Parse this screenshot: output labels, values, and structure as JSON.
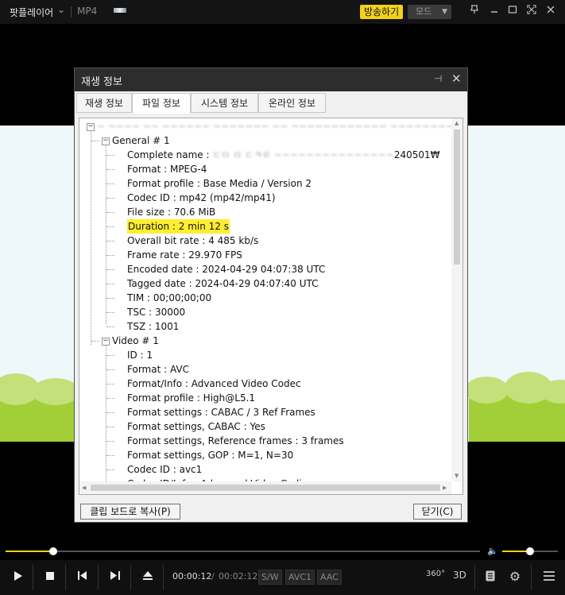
{
  "titlebar": {
    "app_name": "팟플레이어",
    "format": "MP4",
    "broadcast_label": "방송하기",
    "mode_label": "모드"
  },
  "dialog": {
    "title": "재생 정보",
    "tabs": [
      "재생 정보",
      "파일 정보",
      "시스템 정보",
      "온라인 정보"
    ],
    "active_tab": "파일 정보",
    "root_file_suffix": "mp4",
    "root_file_blurred": "~ ~~~~ ~~ ~~~~~~ ~~~~~~~ ~~ ~~~~~~~~~~~~ ~~~~~~~~~~~~~~~~~",
    "sections": [
      {
        "label": "General # 1",
        "rows": [
          "Complete name : ",
          "Format : MPEG-4",
          "Format profile : Base Media / Version 2",
          "Codec ID : mp42 (mp42/mp41)",
          "File size : 70.6 MiB",
          "Duration : 2 min 12 s",
          "Overall bit rate : 4 485 kb/s",
          "Frame rate : 29.970 FPS",
          "Encoded date : 2024-04-29 04:07:38 UTC",
          "Tagged date : 2024-04-29 04:07:40 UTC",
          "TIM : 00;00;00;00",
          "TSC : 30000",
          "TSZ : 1001"
        ],
        "complete_name_blurred": "ㄷㅁ ㅁ ㄷㅋㅌ ~~~~~~~~~~~~~~~",
        "complete_name_suffix": "240501₩",
        "highlight_index": 5
      },
      {
        "label": "Video # 1",
        "rows": [
          "ID : 1",
          "Format : AVC",
          "Format/Info : Advanced Video Codec",
          "Format profile : High@L5.1",
          "Format settings : CABAC / 3 Ref Frames",
          "Format settings, CABAC : Yes",
          "Format settings, Reference frames : 3 frames",
          "Format settings, GOP : M=1, N=30",
          "Codec ID : avc1",
          "Codec ID/Info : Advanced Video Coding"
        ]
      }
    ],
    "copy_button": "클립 보드로 복사(P)",
    "close_button": "닫기(C)"
  },
  "player": {
    "current_time": "00:00:12",
    "separator": "/",
    "total_time": "00:02:12",
    "badges": [
      "S/W",
      "AVC1",
      "AAC"
    ],
    "label_360": "360°",
    "label_3d": "3D",
    "seek_progress": 0.1,
    "volume_level": 0.5,
    "accent_color": "#f2d21c"
  }
}
